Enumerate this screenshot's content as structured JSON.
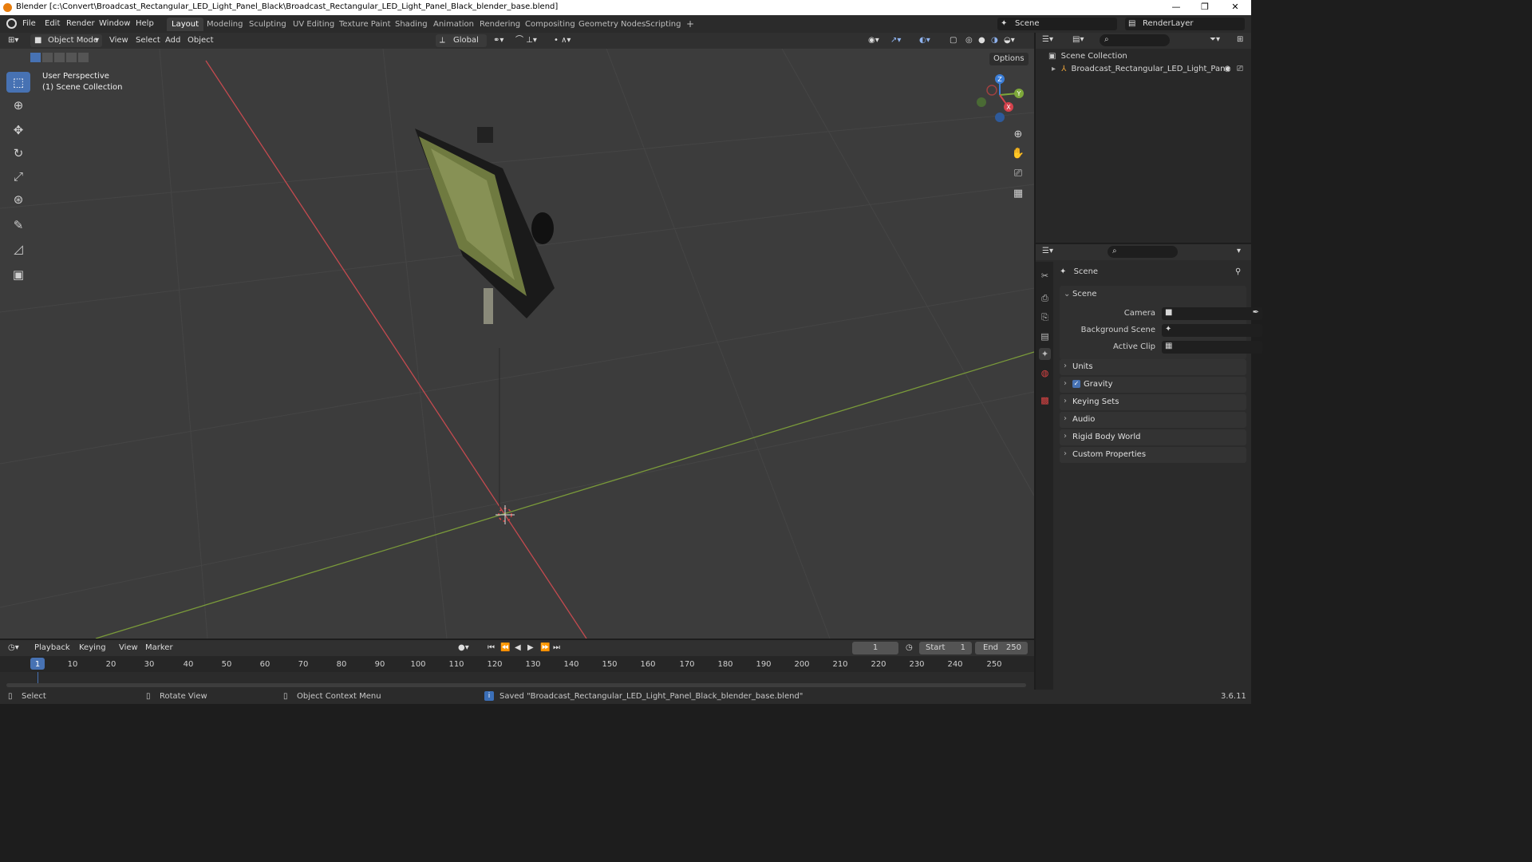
{
  "window": {
    "title": "Blender [c:\\Convert\\Broadcast_Rectangular_LED_Light_Panel_Black\\Broadcast_Rectangular_LED_Light_Panel_Black_blender_base.blend]",
    "minimize": "—",
    "maximize": "❐",
    "close": "✕"
  },
  "menubar": {
    "items": [
      "File",
      "Edit",
      "Render",
      "Window",
      "Help"
    ]
  },
  "workspaces": {
    "tabs": [
      "Layout",
      "Modeling",
      "Sculpting",
      "UV Editing",
      "Texture Paint",
      "Shading",
      "Animation",
      "Rendering",
      "Compositing",
      "Geometry Nodes",
      "Scripting"
    ],
    "add": "+",
    "active": "Layout"
  },
  "scene_selector": {
    "value": "Scene"
  },
  "layer_selector": {
    "value": "RenderLayer"
  },
  "viewport_header": {
    "mode": "Object Mode",
    "menus": [
      "View",
      "Select",
      "Add",
      "Object"
    ],
    "orientation": "Global",
    "options": "Options"
  },
  "viewport": {
    "perspective": "User Perspective",
    "collection": "(1) Scene Collection",
    "gizmo": {
      "x": "X",
      "y": "Y",
      "z": "Z"
    }
  },
  "outliner": {
    "root": "Scene Collection",
    "items": [
      {
        "label": "Broadcast_Rectangular_LED_Light_Pane"
      }
    ]
  },
  "properties": {
    "context": "Scene",
    "section_title": "Scene",
    "fields": [
      {
        "label": "Camera"
      },
      {
        "label": "Background Scene"
      },
      {
        "label": "Active Clip"
      }
    ],
    "panels": [
      "Units",
      "Gravity",
      "Keying Sets",
      "Audio",
      "Rigid Body World",
      "Custom Properties"
    ],
    "gravity_checked": true
  },
  "timeline": {
    "menus": [
      "Playback",
      "Keying",
      "View",
      "Marker"
    ],
    "current_frame": "1",
    "start_label": "Start",
    "start": "1",
    "end_label": "End",
    "end": "250",
    "ticks": [
      "1",
      "10",
      "20",
      "30",
      "40",
      "50",
      "60",
      "70",
      "80",
      "90",
      "100",
      "110",
      "120",
      "130",
      "140",
      "150",
      "160",
      "170",
      "180",
      "190",
      "200",
      "210",
      "220",
      "230",
      "240",
      "250"
    ]
  },
  "statusbar": {
    "select": "Select",
    "rotate": "Rotate View",
    "context_menu": "Object Context Menu",
    "message": "Saved \"Broadcast_Rectangular_LED_Light_Panel_Black_blender_base.blend\"",
    "version": "3.6.11"
  },
  "colors": {
    "accent": "#4772b3",
    "x_axis": "#d4424c",
    "y_axis": "#7ea83a",
    "z_axis": "#3b7ed8"
  }
}
